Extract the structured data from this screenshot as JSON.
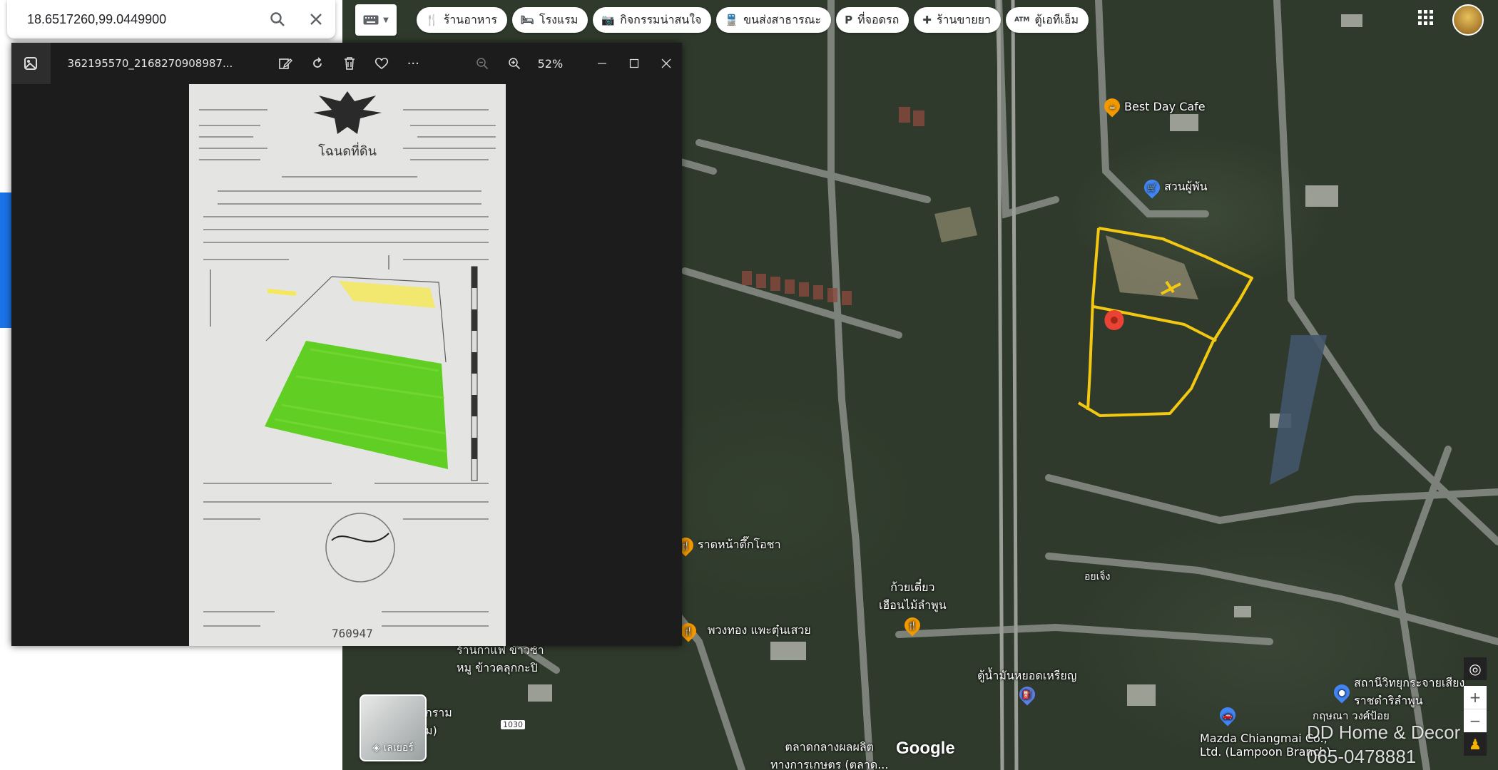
{
  "search": {
    "value": "18.6517260,99.0449900"
  },
  "chips": [
    {
      "icon": "restaurant-icon",
      "glyph": "🍴",
      "label": "ร้านอาหาร"
    },
    {
      "icon": "hotel-icon",
      "glyph": "🛏",
      "label": "โรงแรม"
    },
    {
      "icon": "camera-icon",
      "glyph": "📷",
      "label": "กิจกรรมน่าสนใจ"
    },
    {
      "icon": "transit-icon",
      "glyph": "🚆",
      "label": "ขนส่งสาธารณะ"
    },
    {
      "icon": "parking-icon",
      "glyph": "P",
      "label": "ที่จอดรถ"
    },
    {
      "icon": "pharmacy-icon",
      "glyph": "✚",
      "label": "ร้านขายยา"
    },
    {
      "icon": "atm-icon",
      "glyph": "ATM",
      "label": "ตู้เอทีเอ็ม"
    }
  ],
  "viewer": {
    "file_name": "362195570_2168270908987...",
    "zoom": "52%",
    "toolbar": [
      "edit-icon",
      "rotate-icon",
      "delete-icon",
      "favorite-icon",
      "more-icon"
    ]
  },
  "document": {
    "title": "โฉนดที่ดิน",
    "serial": "760947"
  },
  "map_labels": {
    "best_day_cafe": "Best Day Cafe",
    "suan": "สวนผู้พัน",
    "rad_na": "ราดหน้าตึ๊กโอชา",
    "kuay_tiew": "ก้วยเตี๋ยว",
    "kuay_tiew2": "เฮือนไม้ลำพูน",
    "puang_thong": "พวงทอง แพะตุ๋นเสวย",
    "ran_kao": "ร้านกาแฟ ข้าวซ้า",
    "ran_kao2": "หมู ข้าวคลุกกะปิ",
    "road_name": "อยเจ็ง",
    "gas": "ตู้น้ำมันหยอดเหรียญ",
    "radio": "สถานีวิทยุกระจายเสียง",
    "radio2": "ราชดำริลำพูน",
    "mazda": "Mazda Chiangmai Co.,",
    "mazda2": "Ltd. (Lampoon Branch)",
    "market": "ตลาดกลางผลผลิต",
    "market2": "ทางการเกษตร (ตลาด...",
    "road_1030": "1030",
    "left_edge": "กราม",
    "left_edge2": "ม)",
    "right_bottom": "กฤษณา วงศ์ป้อย"
  },
  "layers_label": "เลเยอร์",
  "google": "Google",
  "watermark": {
    "line1": "DD Home & Decor",
    "line2": "065-0478881"
  },
  "colors": {
    "chip_bg": "#ffffff",
    "marker": "#ea4335",
    "outline": "#f2c811",
    "green_fill": "#55cc11"
  }
}
